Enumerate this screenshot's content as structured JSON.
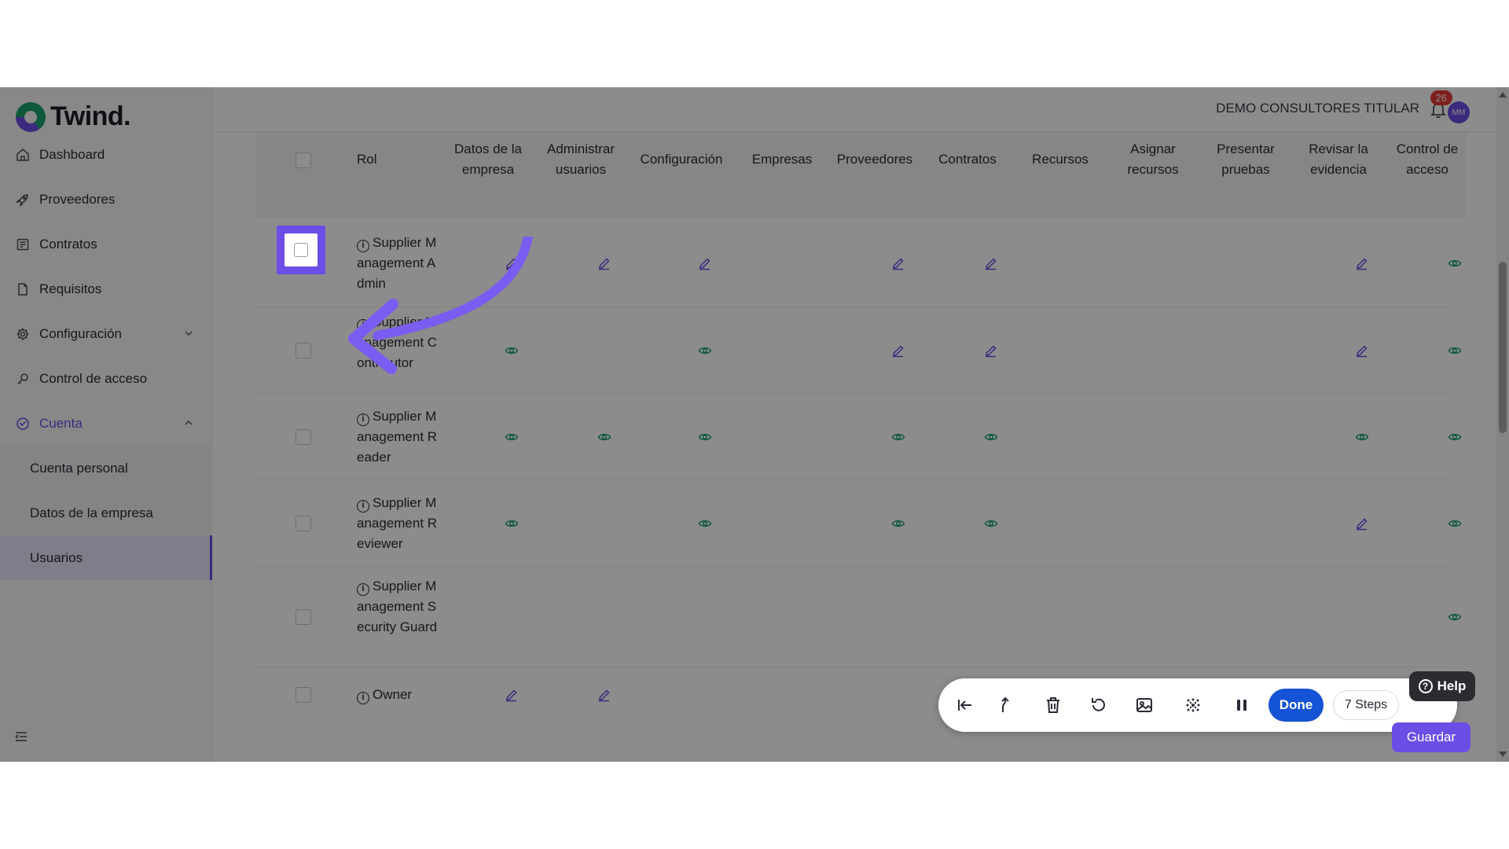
{
  "app": {
    "logo_text": "Twind."
  },
  "sidebar": {
    "items": [
      {
        "label": "Dashboard",
        "icon": "home-icon"
      },
      {
        "label": "Proveedores",
        "icon": "rocket-icon"
      },
      {
        "label": "Contratos",
        "icon": "contract-icon"
      },
      {
        "label": "Requisitos",
        "icon": "document-icon"
      },
      {
        "label": "Configuración",
        "icon": "gear-icon"
      },
      {
        "label": "Control de acceso",
        "icon": "key-icon"
      },
      {
        "label": "Cuenta",
        "icon": "account-icon"
      }
    ],
    "subitems": [
      {
        "label": "Cuenta personal"
      },
      {
        "label": "Datos de la empresa"
      },
      {
        "label": "Usuarios"
      }
    ]
  },
  "topbar": {
    "company": "DEMO CONSULTORES TITULAR",
    "notifications": "26",
    "avatar_initials": "MM"
  },
  "table": {
    "headers": [
      "Rol",
      "Datos de la empresa",
      "Administrar usuarios",
      "Configuración",
      "Empresas",
      "Proveedores",
      "Contratos",
      "Recursos",
      "Asignar recursos",
      "Presentar pruebas",
      "Revisar la evidencia",
      "Control de acceso"
    ],
    "rows": [
      {
        "role": "Supplier Management Admin",
        "perms": [
          "edit",
          "edit",
          "edit",
          "",
          "edit",
          "edit",
          "",
          "",
          "",
          "edit",
          "view"
        ]
      },
      {
        "role": "Supplier Management Contributor",
        "perms": [
          "view",
          "",
          "view",
          "",
          "edit",
          "edit",
          "",
          "",
          "",
          "edit",
          "view"
        ]
      },
      {
        "role": "Supplier Management Reader",
        "perms": [
          "view",
          "view",
          "view",
          "",
          "view",
          "view",
          "",
          "",
          "",
          "view",
          "view"
        ]
      },
      {
        "role": "Supplier Management Reviewer",
        "perms": [
          "view",
          "",
          "view",
          "",
          "view",
          "view",
          "",
          "",
          "",
          "edit",
          "view"
        ]
      },
      {
        "role": "Supplier Management Security Guard",
        "perms": [
          "",
          "",
          "",
          "",
          "",
          "",
          "",
          "",
          "",
          "",
          "view"
        ]
      },
      {
        "role": "Owner",
        "perms": [
          "edit",
          "edit",
          "",
          "",
          "",
          "",
          "",
          "",
          "",
          "",
          ""
        ]
      }
    ]
  },
  "toolbar": {
    "icons": [
      "jump-to-start-icon",
      "branch-up-icon",
      "trash-icon",
      "undo-icon",
      "image-icon",
      "blur-icon",
      "pause-icon"
    ],
    "done_label": "Done",
    "steps_label": "7 Steps"
  },
  "help_label": "Help",
  "save_label": "Guardar",
  "colors": {
    "accent": "#6c4de6",
    "view": "#1aa06d",
    "done": "#1553d6"
  }
}
